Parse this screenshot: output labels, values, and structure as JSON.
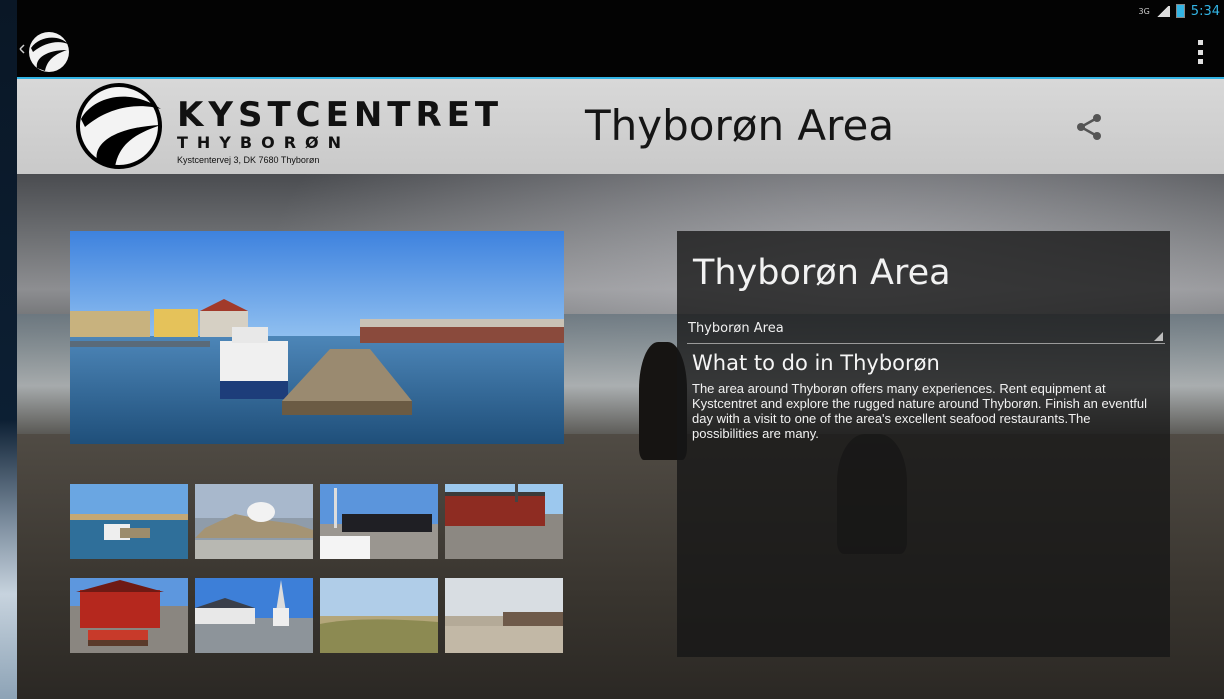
{
  "status_bar": {
    "network": "3G",
    "time": "5:34"
  },
  "header": {
    "brand_name": "KYSTCENTRET",
    "brand_sub": "THYBORØN",
    "brand_address": "Kystcentervej 3, DK 7680 Thyborøn",
    "title": "Thyborøn Area"
  },
  "info": {
    "title": "Thyborøn Area",
    "area_select_value": "Thyborøn Area",
    "section_heading": "What to do in Thyborøn",
    "section_body": "The area around Thyborøn offers many experiences. Rent equipment at Kystcentret and explore the rugged nature around Thyborøn. Finish an eventful day with a visit to one of the area's excellent seafood restaurants.The possibilities are many."
  },
  "colors": {
    "accent": "#33b5e5",
    "header_bg": "#d0d0d0",
    "panel_bg": "#161616"
  }
}
